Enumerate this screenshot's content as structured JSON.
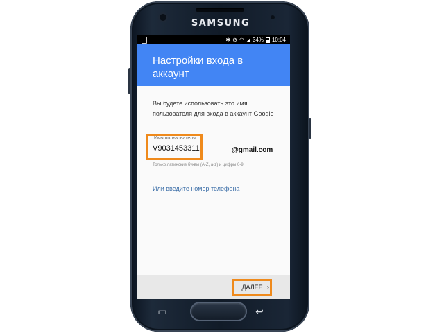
{
  "device": {
    "brand": "SAMSUNG"
  },
  "status_bar": {
    "battery": "34%",
    "time": "10:04"
  },
  "screen": {
    "title": "Настройки входа в аккаунт",
    "description": "Вы будете использовать это имя пользователя для входа в аккаунт Google",
    "username": {
      "label": "Имя пользователя",
      "value": "V9031453311",
      "suffix": "@gmail.com",
      "hint": "Только латинские буквы (A-Z, a-z) и цифры 0-9"
    },
    "phone_link": "Или введите номер телефона",
    "next_button": "ДАЛЕЕ"
  },
  "colors": {
    "header": "#4285f4",
    "link": "#3d6fa8",
    "highlight": "#ef8a1c"
  },
  "icons": {
    "status": [
      "bluetooth-icon",
      "mute-icon",
      "wifi-icon",
      "signal-icon",
      "battery-icon"
    ],
    "navigation": [
      "recents-icon",
      "back-icon",
      "chevron-right-icon"
    ]
  }
}
